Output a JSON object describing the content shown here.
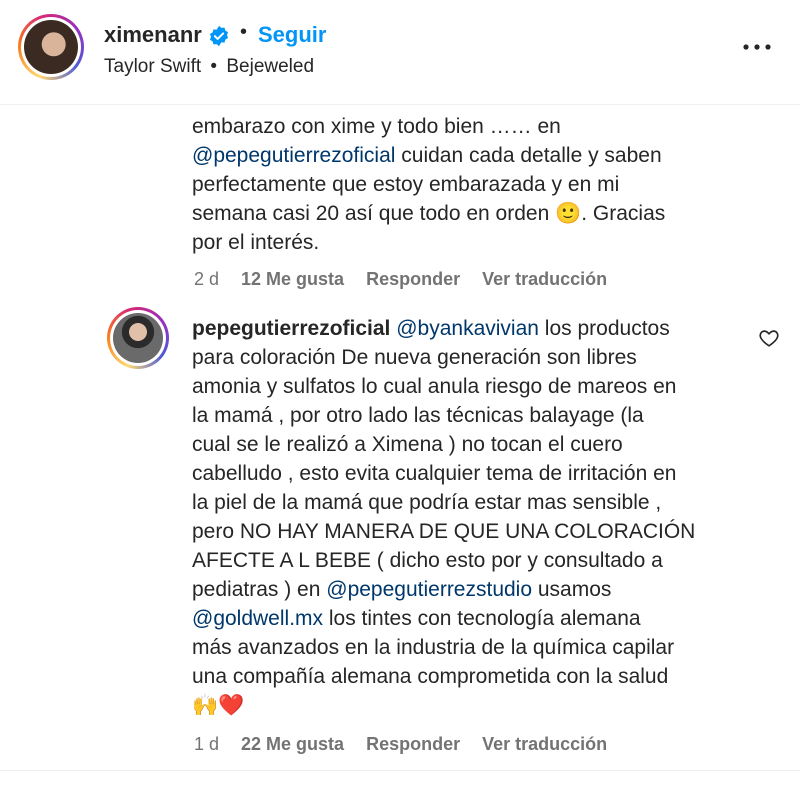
{
  "post": {
    "username": "ximenanr",
    "follow_label": "Seguir",
    "separator": "•",
    "song_artist": "Taylor Swift",
    "song_title": "Bejeweled"
  },
  "comments": [
    {
      "lines": [
        [
          {
            "t": "embarazo con xime y todo bien …… en"
          }
        ],
        [
          {
            "t": "@pepegutierrezoficial",
            "m": true
          },
          {
            "t": " cuidan cada detalle y saben"
          }
        ],
        [
          {
            "t": "perfectamente que estoy embarazada y en mi"
          }
        ],
        [
          {
            "t": "semana casi 20 así que todo en orden 🙂. Gracias"
          }
        ],
        [
          {
            "t": "por el interés."
          }
        ]
      ],
      "time": "2 d",
      "likes": "12 Me gusta",
      "reply_label": "Responder",
      "translate_label": "Ver traducción"
    },
    {
      "username": "pepegutierrezoficial",
      "lines": [
        [
          {
            "t": "pepegutierrezoficial",
            "u": true
          },
          {
            "t": " "
          },
          {
            "t": "@byankavivian",
            "m": true
          },
          {
            "t": " los productos"
          }
        ],
        [
          {
            "t": "para coloración De nueva generación son libres"
          }
        ],
        [
          {
            "t": "amonia y sulfatos lo cual anula riesgo de mareos en"
          }
        ],
        [
          {
            "t": "la mamá , por otro lado las técnicas balayage (la"
          }
        ],
        [
          {
            "t": "cual se le realizó a Ximena ) no tocan el cuero"
          }
        ],
        [
          {
            "t": "cabelludo , esto evita cualquier tema de irritación en"
          }
        ],
        [
          {
            "t": "la piel de la mamá que podría estar mas sensible ,"
          }
        ],
        [
          {
            "t": "pero NO HAY MANERA DE QUE UNA COLORACIÓN"
          }
        ],
        [
          {
            "t": "AFECTE A L BEBE ( dicho esto por y consultado a"
          }
        ],
        [
          {
            "t": "pediatras ) en "
          },
          {
            "t": "@pepegutierrezstudio",
            "m": true
          },
          {
            "t": " usamos"
          }
        ],
        [
          {
            "t": "@goldwell.mx",
            "m": true
          },
          {
            "t": " los tintes con tecnología alemana"
          }
        ],
        [
          {
            "t": "más avanzados en la industria de la química capilar"
          }
        ],
        [
          {
            "t": "una compañía alemana comprometida con la salud"
          }
        ],
        [
          {
            "t": "🙌❤️"
          }
        ]
      ],
      "time": "1 d",
      "likes": "22 Me gusta",
      "reply_label": "Responder",
      "translate_label": "Ver traducción"
    }
  ],
  "icons": {
    "verified": "verified-badge-icon",
    "more": "more-options-icon",
    "heart": "heart-outline-icon"
  },
  "colors": {
    "link_blue": "#0095f6",
    "mention": "#00376b",
    "muted": "#737373",
    "verified": "#0095f6"
  }
}
